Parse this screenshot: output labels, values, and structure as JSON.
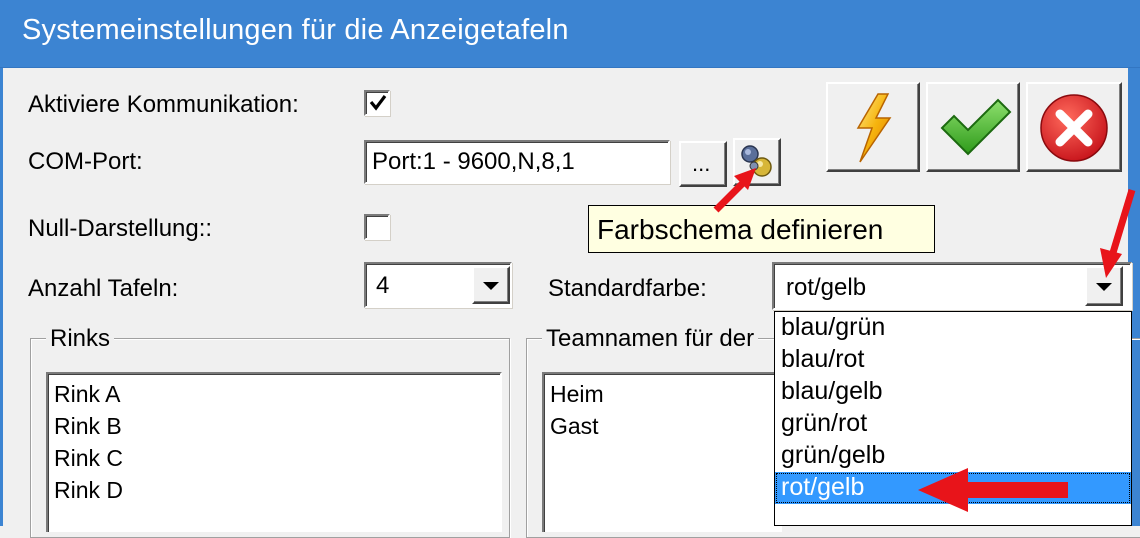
{
  "window": {
    "title": "Systemeinstellungen für die Anzeigetafeln"
  },
  "form": {
    "activate_comm_label": "Aktiviere Kommunikation:",
    "activate_comm_checked": true,
    "com_port_label": "COM-Port:",
    "com_port_value": "Port:1 - 9600,N,8,1",
    "browse_label": "...",
    "null_display_label": "Null-Darstellung::",
    "null_display_checked": false,
    "boards_count_label": "Anzahl Tafeln:",
    "boards_count_value": "4",
    "default_color_label": "Standardfarbe:",
    "default_color_value": "rot/gelb"
  },
  "tooltip": {
    "text": "Farbschema definieren"
  },
  "toolbar": {
    "buttons": [
      {
        "name": "lightning-icon"
      },
      {
        "name": "checkmark-icon"
      },
      {
        "name": "cancel-icon"
      }
    ]
  },
  "rinks": {
    "label": "Rinks",
    "items": [
      "Rink A",
      "Rink B",
      "Rink C",
      "Rink D"
    ]
  },
  "teams": {
    "label": "Teamnamen für der",
    "items": [
      "Heim",
      "Gast"
    ]
  },
  "color_dropdown": {
    "options": [
      "blau/grün",
      "blau/rot",
      "blau/gelb",
      "grün/rot",
      "grün/gelb",
      "rot/gelb"
    ],
    "selected_index": 5
  },
  "colors": {
    "title_bar": "#3c84d2",
    "selection": "#3399ff",
    "tooltip_bg": "#ffffe1",
    "annotation_arrow": "#e8141a"
  }
}
